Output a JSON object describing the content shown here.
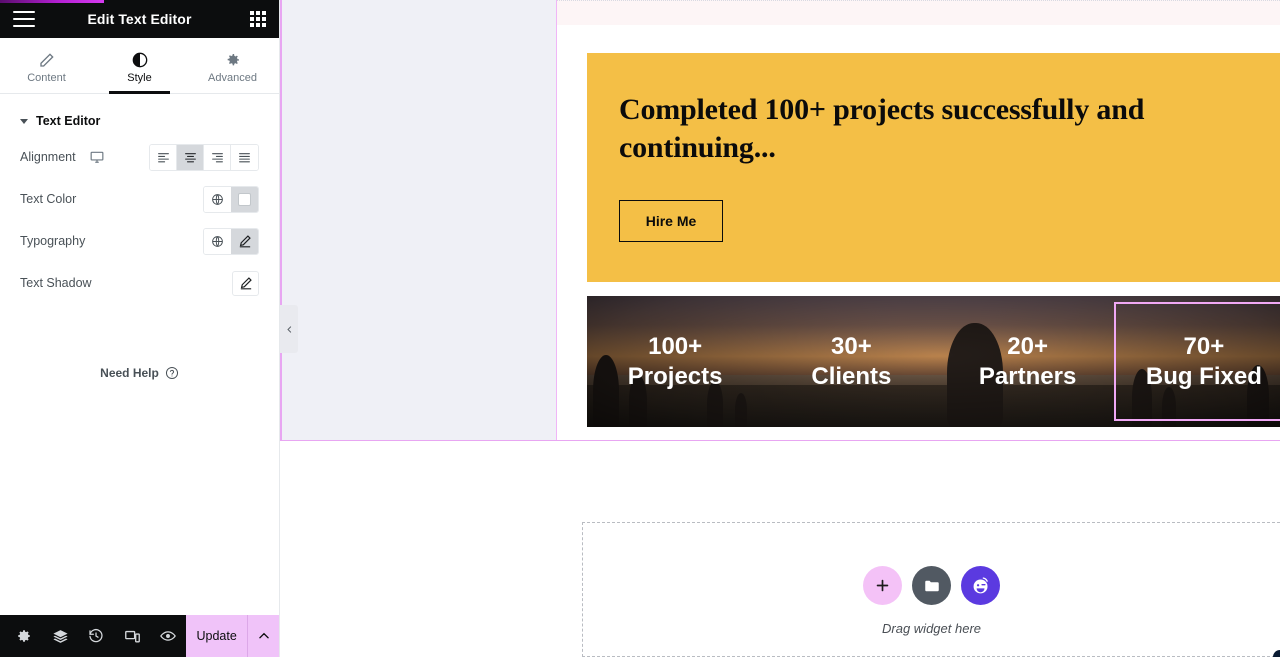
{
  "panel": {
    "header": {
      "title": "Edit Text Editor",
      "menu_icon": "hamburger-icon",
      "apps_icon": "grid-apps-icon"
    },
    "tabs": [
      {
        "label": "Content",
        "icon": "pencil-icon",
        "active": false
      },
      {
        "label": "Style",
        "icon": "contrast-icon",
        "active": true
      },
      {
        "label": "Advanced",
        "icon": "gear-icon",
        "active": false
      }
    ],
    "section": {
      "title": "Text Editor",
      "expanded": true
    },
    "controls": [
      {
        "label": "Alignment",
        "device_icon": "desktop-icon",
        "type": "button-group",
        "options": [
          "align-left",
          "align-center",
          "align-right",
          "align-justify"
        ],
        "selected_index": 1
      },
      {
        "label": "Text Color",
        "type": "color",
        "globe_icon": "globe-icon",
        "value": "#ffffff"
      },
      {
        "label": "Typography",
        "type": "edit",
        "globe_icon": "globe-icon",
        "edit_icon": "pencil-icon",
        "active": true
      },
      {
        "label": "Text Shadow",
        "type": "edit",
        "edit_icon": "pencil-icon",
        "active": false
      }
    ],
    "need_help": {
      "label": "Need Help",
      "icon": "question-circle-icon"
    },
    "footer": {
      "tools": [
        {
          "name": "settings-icon",
          "title": "Settings"
        },
        {
          "name": "layers-icon",
          "title": "Navigator"
        },
        {
          "name": "history-icon",
          "title": "History"
        },
        {
          "name": "responsive-icon",
          "title": "Responsive Mode"
        },
        {
          "name": "preview-icon",
          "title": "Preview Changes"
        }
      ],
      "update_label": "Update",
      "caret_icon": "chevron-up-icon"
    }
  },
  "canvas": {
    "collapse_handle_icon": "chevron-left-icon",
    "hero": {
      "heading": "Completed 100+ projects successfully and continuing...",
      "button_label": "Hire Me",
      "background_color": "#f4bf46"
    },
    "stats": [
      {
        "number": "100+",
        "label": "Projects",
        "selected": false
      },
      {
        "number": "30+",
        "label": "Clients",
        "selected": false
      },
      {
        "number": "20+",
        "label": "Partners",
        "selected": false
      },
      {
        "number": "70+",
        "label": "Bug Fixed",
        "selected": true
      }
    ],
    "dropzone": {
      "label": "Drag widget here",
      "buttons": [
        {
          "name": "add-widget-icon",
          "color": "#f4c2f7"
        },
        {
          "name": "folder-template-icon",
          "color": "#515962"
        },
        {
          "name": "ai-face-icon",
          "color": "#5b3ae0"
        }
      ]
    },
    "selection_color": "#e8a6f2"
  }
}
